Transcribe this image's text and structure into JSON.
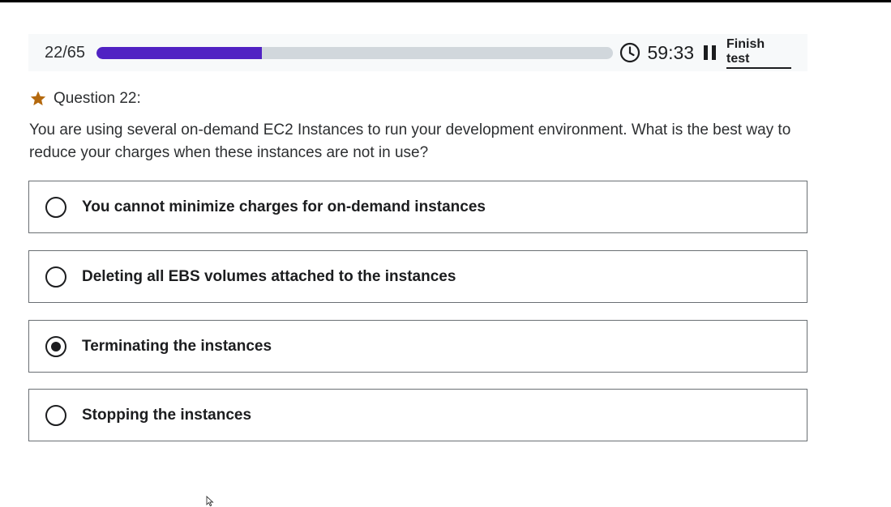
{
  "header": {
    "progress_count": "22/65",
    "progress_fraction": 0.32,
    "timer": "59:33",
    "finish_label": "Finish test",
    "progress_color": "#5022c3"
  },
  "question": {
    "label": "Question 22:",
    "text": "You are using several on-demand EC2 Instances to run your development environment. What is the best way to reduce your charges when these instances are not in use?",
    "star_color": "#b4690e"
  },
  "options": [
    {
      "label": "You cannot minimize charges for on-demand instances",
      "selected": false
    },
    {
      "label": "Deleting all EBS volumes attached to the instances",
      "selected": false
    },
    {
      "label": "Terminating the instances",
      "selected": true
    },
    {
      "label": "Stopping the instances",
      "selected": false
    }
  ],
  "icons": {
    "timer": "clock-icon",
    "pause": "pause-icon",
    "bookmark": "star-icon",
    "cursor": "mouse-pointer-icon"
  }
}
